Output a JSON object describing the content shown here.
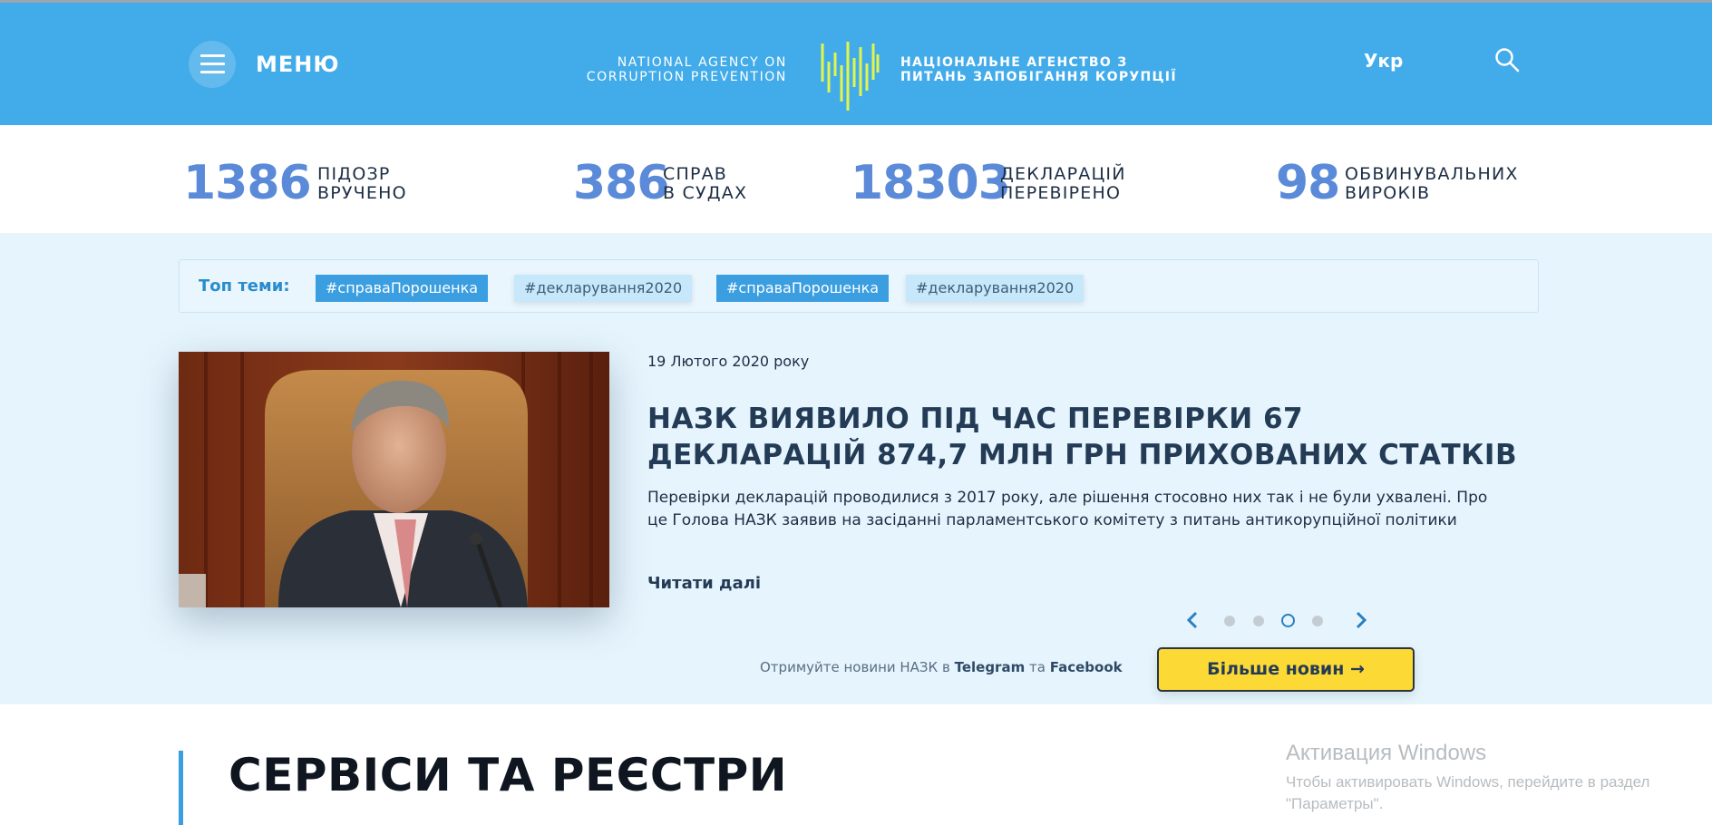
{
  "header": {
    "menu_label": "МЕНЮ",
    "logo_en_line1": "NATIONAL AGENCY ON",
    "logo_en_line2": "CORRUPTION PREVENTION",
    "logo_ua_line1": "НАЦІОНАЛЬНЕ АГЕНСТВО З",
    "logo_ua_line2": "ПИТАНЬ ЗАПОБІГАННЯ КОРУПЦІЇ",
    "language": "Укр",
    "brand_color": "#42abea",
    "logo_color": "#e4f54a"
  },
  "stats": [
    {
      "value": "1386",
      "line1": "ПІДОЗР",
      "line2": "ВРУЧЕНО"
    },
    {
      "value": "386",
      "line1": "СПРАВ",
      "line2": "В СУДАХ"
    },
    {
      "value": "18303",
      "line1": "ДЕКЛАРАЦІЙ",
      "line2": "ПЕРЕВІРЕНО"
    },
    {
      "value": "98",
      "line1": "ОБВИНУВАЛЬНИХ",
      "line2": "ВИРОКІВ"
    }
  ],
  "topics": {
    "label": "Топ теми:",
    "tags": [
      "#справаПорошенка",
      "#декларування2020",
      "#справаПорошенка",
      "#декларування2020"
    ]
  },
  "news": {
    "date": "19 Лютого 2020 року",
    "headline": "НАЗК ВИЯВИЛО ПІД ЧАС ПЕРЕВІРКИ 67 ДЕКЛАРАЦІЙ 874,7 МЛН ГРН ПРИХОВАНИХ СТАТКІВ",
    "lead": "Перевірки декларацій проводилися з 2017 року, але рішення стосовно них так і не були ухвалені. Про це Голова НАЗК заявив на засіданні парламентського комітету з питань антикорупційної політики",
    "read_more": "Читати далі",
    "slides_total": 4,
    "active_slide": 3
  },
  "subscribe": {
    "prefix": "Отримуйте новини НАЗК в",
    "telegram": "Telegram",
    "middle": "та",
    "facebook": "Facebook"
  },
  "more_news_button": "Більше новин →",
  "services_title": "СЕРВІСИ ТА РЕЄСТРИ",
  "windows_watermark": {
    "title": "Активация Windows",
    "line1": "Чтобы активировать Windows, перейдите в раздел",
    "line2": "\"Параметры\"."
  }
}
